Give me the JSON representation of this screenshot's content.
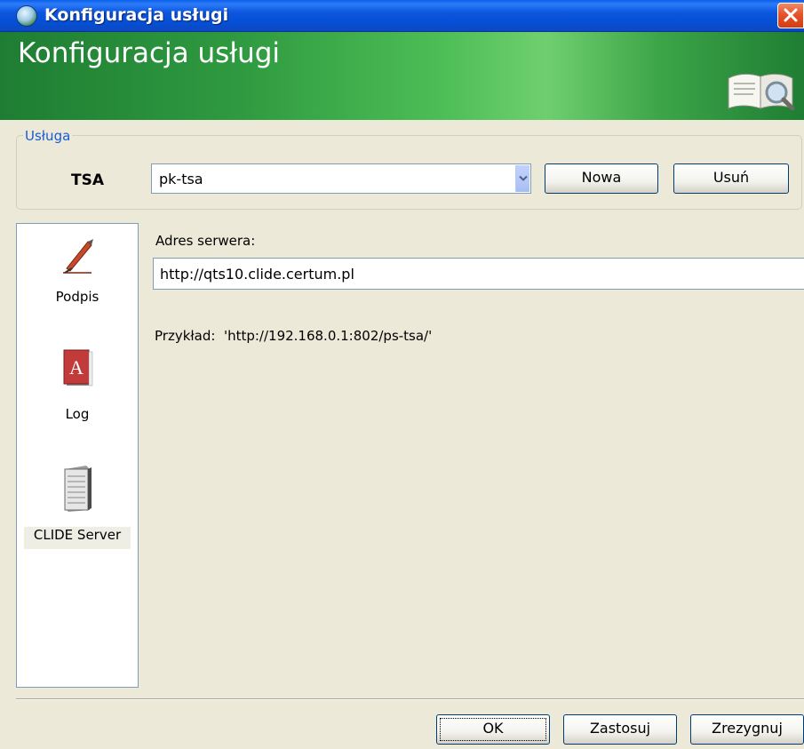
{
  "window": {
    "title": "Konfiguracja usługi",
    "banner_title": "Konfiguracja usługi"
  },
  "service_group": {
    "legend": "Usługa",
    "type_label": "TSA",
    "selected_service": "pk-tsa",
    "new_button": "Nowa",
    "delete_button": "Usuń"
  },
  "nav": {
    "items": [
      {
        "label": "Podpis",
        "icon": "pen-icon"
      },
      {
        "label": "Log",
        "icon": "log-book-icon"
      },
      {
        "label": "CLIDE Server",
        "icon": "server-icon",
        "selected": true
      }
    ]
  },
  "content": {
    "address_label": "Adres serwera:",
    "address_value": "http://qts10.clide.certum.pl",
    "example_text": "Przykład:  'http://192.168.0.1:802/ps-tsa/'"
  },
  "footer": {
    "ok_button": "OK",
    "apply_button": "Zastosuj",
    "cancel_button": "Zrezygnuj"
  },
  "colors": {
    "titlebar": "#0A5FEC",
    "banner_green": "#2F9A40",
    "legend_blue": "#1A5AD6",
    "dialog_bg": "#ECE9D8"
  }
}
